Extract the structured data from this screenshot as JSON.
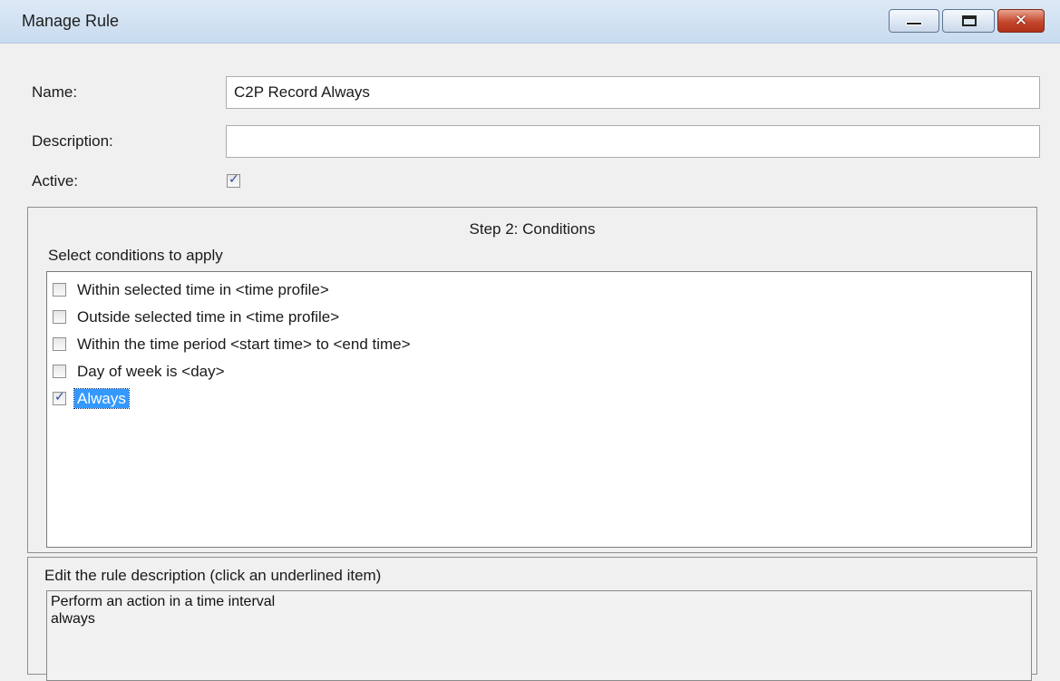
{
  "window": {
    "title": "Manage Rule",
    "controls": {
      "minimize_icon": "minimize-icon",
      "maximize_icon": "maximize-icon",
      "close_icon": "close-icon",
      "close_glyph": "✕"
    }
  },
  "form": {
    "name_label": "Name:",
    "name_value": "C2P Record Always",
    "description_label": "Description:",
    "description_value": "",
    "active_label": "Active:",
    "active_checked": true
  },
  "conditions": {
    "group_title": "Step 2: Conditions",
    "select_label": "Select conditions to apply",
    "items": [
      {
        "label": "Within selected time in <time profile>",
        "checked": false,
        "selected": false
      },
      {
        "label": "Outside selected time in <time profile>",
        "checked": false,
        "selected": false
      },
      {
        "label": "Within the time period <start time> to <end time>",
        "checked": false,
        "selected": false
      },
      {
        "label": "Day of week is <day>",
        "checked": false,
        "selected": false
      },
      {
        "label": "Always",
        "checked": true,
        "selected": true
      }
    ]
  },
  "rule_description": {
    "title": "Edit the rule description (click an underlined item)",
    "line1": "Perform an action in a time interval",
    "line2": "always"
  },
  "colors": {
    "selection": "#3399ff",
    "check": "#2a4c9c",
    "close_button": "#c4472c"
  }
}
